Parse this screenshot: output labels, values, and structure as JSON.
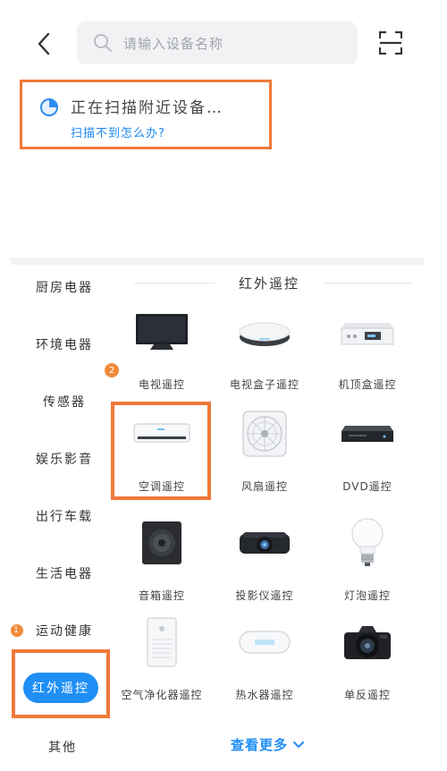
{
  "header": {
    "search_placeholder": "请输入设备名称",
    "icons": {
      "back": "back-arrow-icon",
      "search": "search-icon",
      "scan": "scan-icon"
    }
  },
  "scan_panel": {
    "status": "正在扫描附近设备…",
    "help_link": "扫描不到怎么办?"
  },
  "sidebar": {
    "items": [
      {
        "label": "厨房电器"
      },
      {
        "label": "环境电器"
      },
      {
        "label": "传感器"
      },
      {
        "label": "娱乐影音"
      },
      {
        "label": "出行车载"
      },
      {
        "label": "生活电器"
      },
      {
        "label": "运动健康",
        "badge": "1"
      },
      {
        "label": "红外遥控",
        "active": true
      },
      {
        "label": "其他"
      }
    ]
  },
  "section": {
    "title": "红外遥控",
    "grid_badge": "2"
  },
  "grid": [
    {
      "label": "电视遥控",
      "icon": "tv-icon"
    },
    {
      "label": "电视盒子遥控",
      "icon": "tv-box-icon"
    },
    {
      "label": "机顶盒遥控",
      "icon": "set-top-box-icon"
    },
    {
      "label": "空调遥控",
      "icon": "air-conditioner-icon"
    },
    {
      "label": "风扇遥控",
      "icon": "fan-icon"
    },
    {
      "label": "DVD遥控",
      "icon": "dvd-player-icon"
    },
    {
      "label": "音箱遥控",
      "icon": "speaker-icon"
    },
    {
      "label": "投影仪遥控",
      "icon": "projector-icon"
    },
    {
      "label": "灯泡遥控",
      "icon": "light-bulb-icon"
    },
    {
      "label": "空气净化器遥控",
      "icon": "air-purifier-icon"
    },
    {
      "label": "热水器遥控",
      "icon": "water-heater-icon"
    },
    {
      "label": "单反遥控",
      "icon": "dslr-camera-icon"
    }
  ],
  "more": {
    "label": "查看更多"
  },
  "colors": {
    "accent": "#1f8ff5",
    "highlight": "#f0793a",
    "badge": "#f08a3c"
  }
}
